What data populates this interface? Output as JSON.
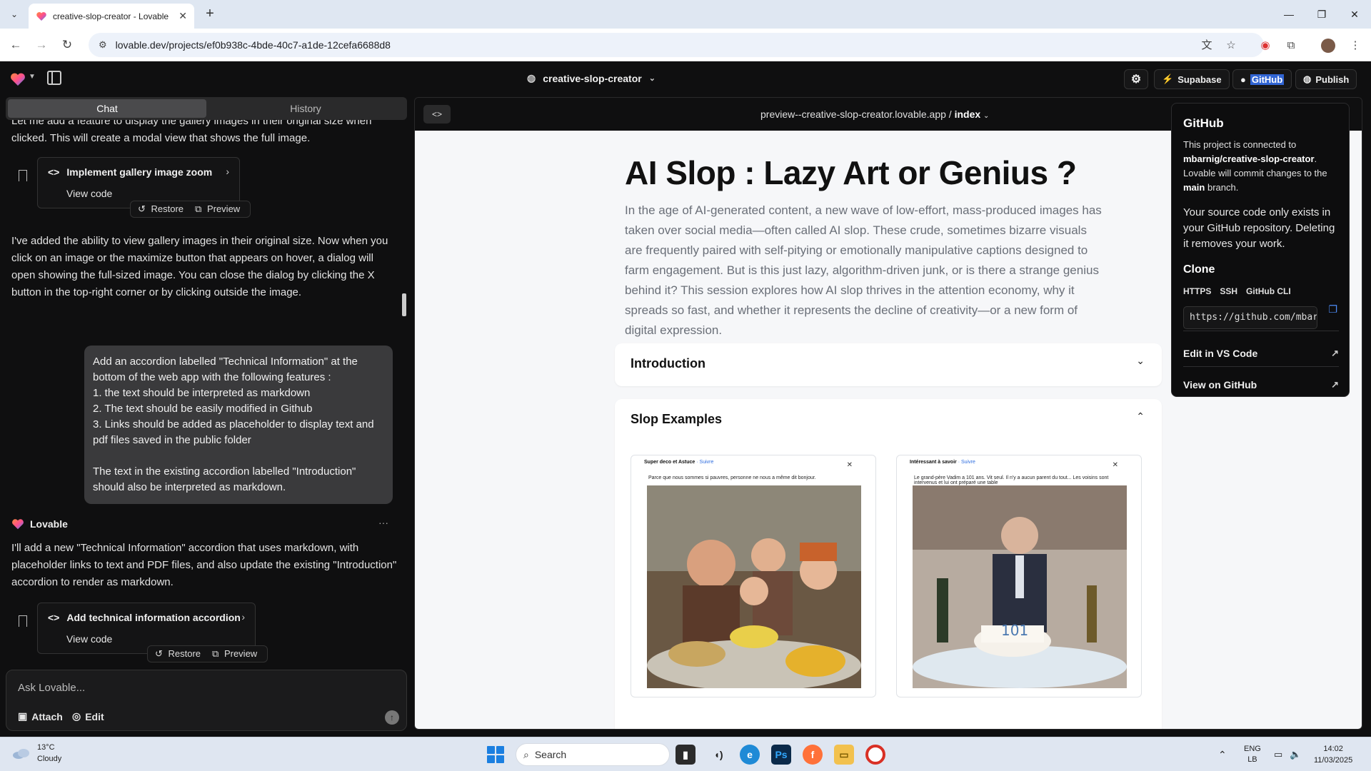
{
  "browser": {
    "tab_title": "creative-slop-creator - Lovable",
    "url": "lovable.dev/projects/ef0b938c-4bde-40c7-a1de-12cefa6688d8"
  },
  "app_header": {
    "project_name": "creative-slop-creator",
    "supabase_label": "Supabase",
    "github_label": "GitHub",
    "publish_label": "Publish"
  },
  "chat": {
    "tabs": [
      "Chat",
      "History"
    ],
    "partial_text": "Let me add a feature to display the gallery images in their original size when clicked. This will create a modal view that shows the full image.",
    "card1": {
      "title": "Implement gallery image zoom",
      "sub": "View code",
      "restore": "Restore",
      "preview": "Preview"
    },
    "reply1": "I've added the ability to view gallery images in their original size. Now when you click on an image or the maximize button that appears on hover, a dialog will open showing the full-sized image. You can close the dialog by clicking the X button in the top-right corner or by clicking outside the image.",
    "user_message": "Add an accordion labelled \"Technical Information\" at the bottom of the web app with the following features :\n1. the text should be interpreted as markdown\n2. The text should be easily modified in Github\n3. Links should be added as placeholder to display text and pdf files saved in the public folder\n\nThe text in the existing accordion labelled \"Introduction\" should also be interpreted as markdown.",
    "sender": "Lovable",
    "reply2": "I'll add a new \"Technical Information\" accordion that uses markdown, with placeholder links to text and PDF files, and also update the existing \"Introduction\" accordion to render as markdown.",
    "card2": {
      "title": "Add technical information accordion",
      "sub": "View code",
      "restore": "Restore",
      "preview": "Preview"
    },
    "composer": {
      "placeholder": "Ask Lovable...",
      "attach": "Attach",
      "edit": "Edit"
    }
  },
  "preview": {
    "url_host": "preview--creative-slop-creator.lovable.app /",
    "url_page": "index",
    "title": "AI Slop : Lazy Art or Genius ?",
    "intro": "In the age of AI-generated content, a new wave of low-effort, mass-produced images has taken over social media—often called AI slop. These crude, sometimes bizarre visuals are frequently paired with self-pitying or emotionally manipulative captions designed to farm engagement. But is this just lazy, algorithm-driven junk, or is there a strange genius behind it? This session explores how AI slop thrives in the attention economy, why it spreads so fast, and whether it represents the decline of creativity—or a new form of digital expression.",
    "accordion_intro": "Introduction",
    "accordion_examples": "Slop Examples",
    "examples": [
      {
        "author": "Super deco et Astuce",
        "follow": "· Suivre",
        "caption": "Parce que nous sommes si pauvres, personne ne nous a même dit bonjour."
      },
      {
        "author": "Intéressant à savoir",
        "follow": "· Suivre",
        "caption": "Le grand-père Vadim a 101 ans. Vit seul. Il n'y a aucun parent du tout... Les voisins sont intervenus et lui ont préparé une table"
      }
    ]
  },
  "github_popover": {
    "title": "GitHub",
    "desc_prefix": "This project is connected to",
    "repo": "mbarnig/creative-slop-creator",
    "desc_mid": ". Lovable will commit changes to the",
    "branch": "main",
    "desc_suffix": "branch.",
    "warning": "Your source code only exists in your GitHub repository. Deleting it removes your work.",
    "clone_title": "Clone",
    "clone_tabs": [
      "HTTPS",
      "SSH",
      "GitHub CLI"
    ],
    "clone_url": "https://github.com/mbarnig/creative-slop-creator.git",
    "edit_vscode": "Edit in VS Code",
    "view_github": "View on GitHub"
  },
  "taskbar": {
    "temp": "13°C",
    "weather": "Cloudy",
    "search": "Search",
    "lang": "ENG",
    "region": "LB",
    "time": "14:02",
    "date": "11/03/2025"
  }
}
